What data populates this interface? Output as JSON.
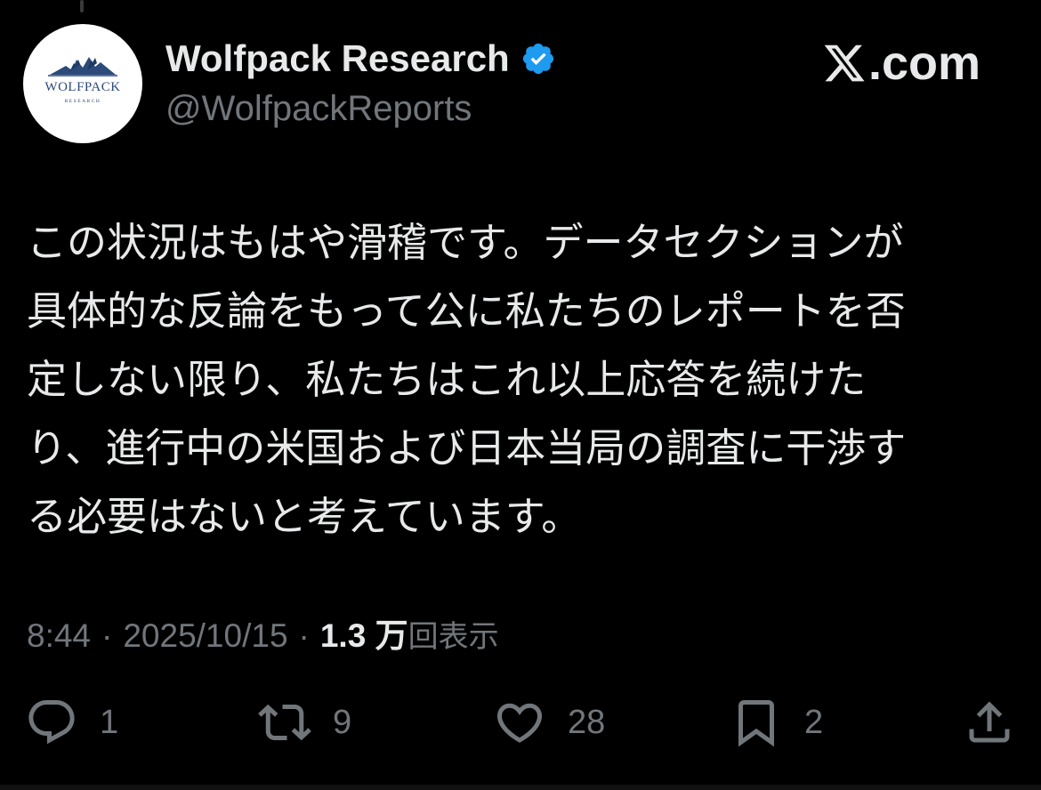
{
  "author": {
    "name": "Wolfpack Research",
    "handle": "@WolfpackReports",
    "avatar_text": "WOLFPACK",
    "avatar_subtext": "RESEARCH"
  },
  "brand": {
    "label": ".com"
  },
  "tweet": {
    "lines": [
      "この状況はもはや滑稽です。データセクションが",
      "具体的な反論をもって公に私たちのレポートを否",
      "定しない限り、私たちはこれ以上応答を続けた",
      "り、進行中の米国および日本当局の調査に干渉す",
      "る必要はないと考えています。"
    ]
  },
  "meta": {
    "time": "8:44",
    "separator": "·",
    "date": "2025/10/15",
    "views_count": "1.3 万",
    "views_label": "回表示"
  },
  "actions": {
    "reply_count": "1",
    "repost_count": "9",
    "like_count": "28",
    "bookmark_count": "2"
  },
  "colors": {
    "background": "#000000",
    "text": "#e7e9ea",
    "muted": "#71767b",
    "verified": "#1d9bf0",
    "logo_blue": "#2c4a7a"
  }
}
